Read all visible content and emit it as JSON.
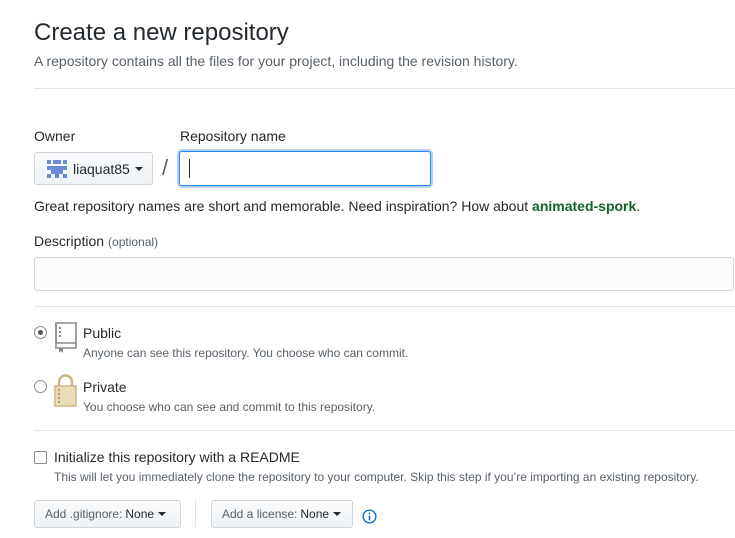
{
  "page": {
    "title": "Create a new repository",
    "subtitle": "A repository contains all the files for your project, including the revision history."
  },
  "owner": {
    "label": "Owner",
    "username": "liaquat85",
    "icon": "identicon-avatar"
  },
  "repository": {
    "label": "Repository name",
    "value": "",
    "separator": "/"
  },
  "hint": {
    "text": "Great repository names are short and memorable. Need inspiration? How about ",
    "suggestion": "animated-spork",
    "end": "."
  },
  "description": {
    "label": "Description",
    "optional": "(optional)",
    "value": "",
    "placeholder": ""
  },
  "visibility": {
    "selected": "public",
    "options": [
      {
        "id": "public",
        "title": "Public",
        "note": "Anyone can see this repository. You choose who can commit.",
        "icon": "repo-icon"
      },
      {
        "id": "private",
        "title": "Private",
        "note": "You choose who can see and commit to this repository.",
        "icon": "lock-icon"
      }
    ]
  },
  "readme": {
    "label": "Initialize this repository with a README",
    "note": "This will let you immediately clone the repository to your computer. Skip this step if you’re importing an existing repository.",
    "checked": false
  },
  "gitignore": {
    "prefix": "Add .gitignore:",
    "value": "None"
  },
  "license": {
    "prefix": "Add a license:",
    "value": "None"
  },
  "colors": {
    "accent_blue": "#0366d6",
    "suggestion_green": "#116329",
    "muted_text": "#586069",
    "border": "#d1d5da"
  }
}
